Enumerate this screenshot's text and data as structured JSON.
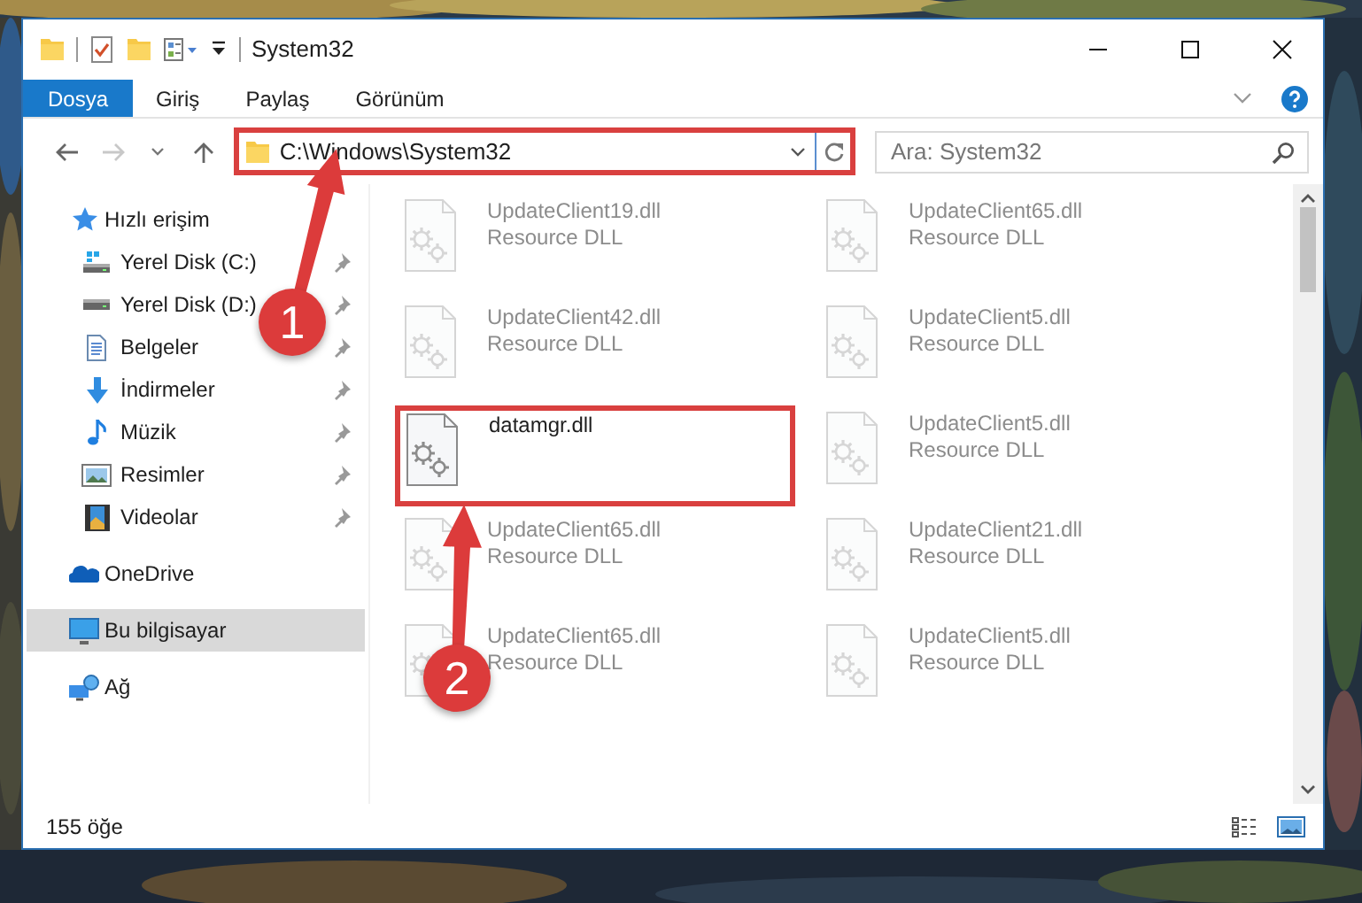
{
  "window": {
    "title": "System32"
  },
  "ribbon_tabs": [
    {
      "label": "Dosya",
      "selected": true
    },
    {
      "label": "Giriş",
      "selected": false
    },
    {
      "label": "Paylaş",
      "selected": false
    },
    {
      "label": "Görünüm",
      "selected": false
    }
  ],
  "address": {
    "path": "C:\\Windows\\System32",
    "highlighted": true
  },
  "search": {
    "placeholder": "Ara: System32"
  },
  "nav": [
    {
      "label": "Hızlı erişim",
      "selected": false,
      "children": [
        {
          "label": "Yerel Disk (C:)",
          "selected": false,
          "pinned": true
        },
        {
          "label": "Yerel Disk (D:)",
          "selected": false,
          "pinned": true
        },
        {
          "label": "Belgeler",
          "selected": false,
          "pinned": true
        },
        {
          "label": "İndirmeler",
          "selected": false,
          "pinned": true
        },
        {
          "label": "Müzik",
          "selected": false,
          "pinned": true
        },
        {
          "label": "Resimler",
          "selected": false,
          "pinned": true
        },
        {
          "label": "Videolar",
          "selected": false,
          "pinned": true
        }
      ]
    },
    {
      "label": "OneDrive",
      "selected": false
    },
    {
      "label": "Bu bilgisayar",
      "selected": true
    },
    {
      "label": "Ağ",
      "selected": false
    }
  ],
  "files": [
    {
      "name": "UpdateClient19.dll",
      "type": "Resource DLL",
      "blurred": true,
      "highlighted": false
    },
    {
      "name": "UpdateClient65.dll",
      "type": "Resource DLL",
      "blurred": true,
      "highlighted": false
    },
    {
      "name": "UpdateClient42.dll",
      "type": "Resource DLL",
      "blurred": true,
      "highlighted": false
    },
    {
      "name": "UpdateClient5.dll",
      "type": "Resource DLL",
      "blurred": true,
      "highlighted": false
    },
    {
      "name": "datamgr.dll",
      "blurred": false,
      "highlighted": true
    },
    {
      "name": "UpdateClient5.dll",
      "type": "Resource DLL",
      "blurred": true,
      "highlighted": false
    },
    {
      "name": "UpdateClient65.dll",
      "type": "Resource DLL",
      "blurred": true,
      "highlighted": false
    },
    {
      "name": "UpdateClient21.dll",
      "type": "Resource DLL",
      "blurred": true,
      "highlighted": false
    },
    {
      "name": "UpdateClient65.dll",
      "type": "Resource DLL",
      "blurred": true,
      "highlighted": false
    },
    {
      "name": "UpdateClient5.dll",
      "type": "Resource DLL",
      "blurred": true,
      "highlighted": false
    }
  ],
  "status_bar": {
    "item_count": "155 öğe"
  },
  "annotations": [
    {
      "label": "1"
    },
    {
      "label": "2"
    }
  ]
}
